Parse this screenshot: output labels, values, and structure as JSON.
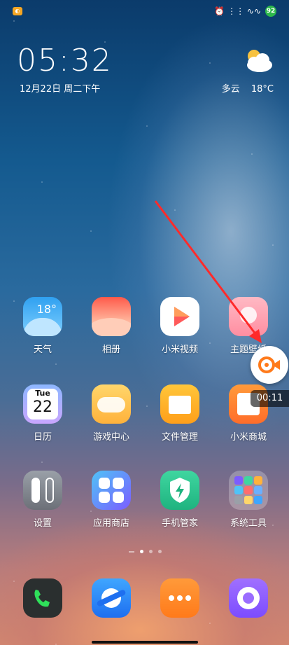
{
  "status": {
    "notif_glyph": "◐",
    "icons": "⏰ ⋮⋮ ∿∿",
    "battery": "92"
  },
  "lock": {
    "time": "05:32",
    "date": "12月22日 周二下午"
  },
  "weather": {
    "desc": "多云",
    "temp": "18°C",
    "icon": "cloud-sun-icon"
  },
  "apps": [
    {
      "label": "天气",
      "icon": "weather-icon",
      "badge": "18°"
    },
    {
      "label": "相册",
      "icon": "gallery-icon"
    },
    {
      "label": "小米视频",
      "icon": "video-icon"
    },
    {
      "label": "主题壁纸",
      "icon": "theme-icon"
    },
    {
      "label": "日历",
      "icon": "calendar-icon",
      "day": "Tue",
      "date": "22"
    },
    {
      "label": "游戏中心",
      "icon": "game-icon"
    },
    {
      "label": "文件管理",
      "icon": "folder-icon"
    },
    {
      "label": "小米商城",
      "icon": "store-icon"
    },
    {
      "label": "设置",
      "icon": "settings-icon"
    },
    {
      "label": "应用商店",
      "icon": "app-store-icon"
    },
    {
      "label": "手机管家",
      "icon": "security-icon"
    },
    {
      "label": "系统工具",
      "icon": "tools-folder-icon"
    }
  ],
  "dock": [
    {
      "icon": "phone-icon"
    },
    {
      "icon": "browser-icon"
    },
    {
      "icon": "messages-icon"
    },
    {
      "icon": "camera-icon"
    }
  ],
  "recorder": {
    "timer": "00:11"
  }
}
